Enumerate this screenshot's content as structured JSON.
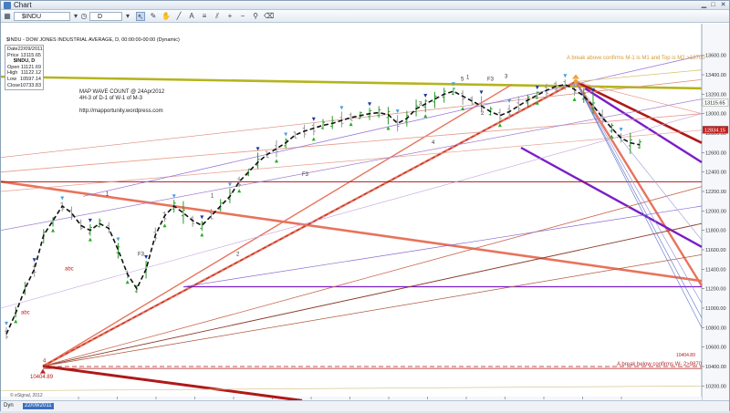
{
  "window": {
    "title": "Chart"
  },
  "toolbar": {
    "symbol": "$INDU",
    "period": "D",
    "buttons": [
      "cursor-icon",
      "pencil-icon",
      "hand-icon",
      "line-icon",
      "text-icon",
      "fib-icon",
      "channel-icon",
      "zoom-in-icon",
      "zoom-out-icon",
      "pin-icon",
      "eraser-icon"
    ]
  },
  "chart_title": "$INDU - DOW JONES INDUSTRIAL AVERAGE, D, 00:00:00-00:00 (Dynamic)",
  "databox": {
    "date_label": "Date",
    "date": "22/09/2011",
    "price_label": "Price",
    "price": "13115.65",
    "symbol": "$INDU, D",
    "open_label": "Open",
    "open": "11121.69",
    "high_label": "High",
    "high": "11122.12",
    "low_label": "Low",
    "low": "10597.14",
    "close_label": "Close",
    "close": "10733.83"
  },
  "notes": {
    "wave_count_1": "MAP WAVE COUNT @ 24Apr2012",
    "wave_count_2": "4H-3 of D-1 of W-1 of M-3",
    "url": "http://mapportunity.wordpress.com",
    "break_above": "A break above confirms M-1 is M1 and Top is M2 >13700",
    "break_below": "A break below confirms W- 2>9870",
    "copyright": "© eSignal, 2012",
    "low_point": "10404.89",
    "right_low": "10404.89"
  },
  "bottombar": {
    "left_label": "Dyn",
    "date": "22/09/2011"
  },
  "colors": {
    "bull_bar": "#2a9a2a",
    "bear_bar": "#999999",
    "olive": "#b4b41e",
    "salmon": "#e8735c",
    "darkred": "#b01818",
    "purple": "#7a1ec8",
    "blue": "#5a6fc8"
  },
  "chart_data": {
    "type": "line",
    "x_tick_labels": [
      "17",
      "Nov",
      "16",
      "Dec",
      "16",
      "2012",
      "17",
      "Feb",
      "16",
      "Mar",
      "16",
      "Apr",
      "16",
      "May",
      "16"
    ],
    "y_ticks": [
      10200,
      10400,
      10600,
      10800,
      11000,
      11200,
      11400,
      11600,
      11800,
      12000,
      12200,
      12400,
      12600,
      12800,
      13000,
      13200,
      13400,
      13600
    ],
    "ylim": [
      10100,
      13700
    ],
    "price_labels": [
      {
        "text": "13115.65",
        "value": 13115
      },
      {
        "text": "12834.15",
        "value": 12834
      }
    ],
    "series": [
      {
        "values": [
          10733,
          10950,
          11200,
          11400,
          11750,
          11900,
          12050,
          11980,
          11850,
          11800,
          11870,
          11820,
          11600,
          11350,
          11200,
          11400,
          11750,
          11950,
          12050,
          11980,
          11900,
          11850,
          11950,
          12050,
          12150,
          12300,
          12400,
          12500,
          12580,
          12640,
          12700,
          12780,
          12820,
          12850,
          12880,
          12900,
          12930,
          12960,
          12980,
          13000,
          13010,
          12990,
          12900,
          12950,
          13050,
          13100,
          13150,
          13200,
          13230,
          13180,
          13130,
          13080,
          13020,
          12980,
          13020,
          13080,
          13140,
          13190,
          13240,
          13280,
          13300,
          13250,
          13180,
          13080,
          12960,
          12850,
          12750,
          12700,
          12680
        ]
      }
    ],
    "wave_labels": [
      {
        "text": "1",
        "value": 12120
      },
      {
        "text": "1",
        "value": 12100
      },
      {
        "text": "2",
        "value": 11500
      },
      {
        "text": "3",
        "value": 13050
      },
      {
        "text": "4",
        "value": 12650
      },
      {
        "text": "5",
        "value": 13300
      },
      {
        "text": "1",
        "value": 13320
      },
      {
        "text": "F3",
        "value": 13300
      },
      {
        "text": "3",
        "value": 13330
      },
      {
        "text": "2",
        "value": 12950
      },
      {
        "text": "F3",
        "value": 12320
      },
      {
        "text": "F3",
        "value": 11500
      },
      {
        "text": "abc",
        "value": 11350
      },
      {
        "text": "abc",
        "value": 10900
      },
      {
        "text": "4",
        "value": 10404
      }
    ]
  }
}
